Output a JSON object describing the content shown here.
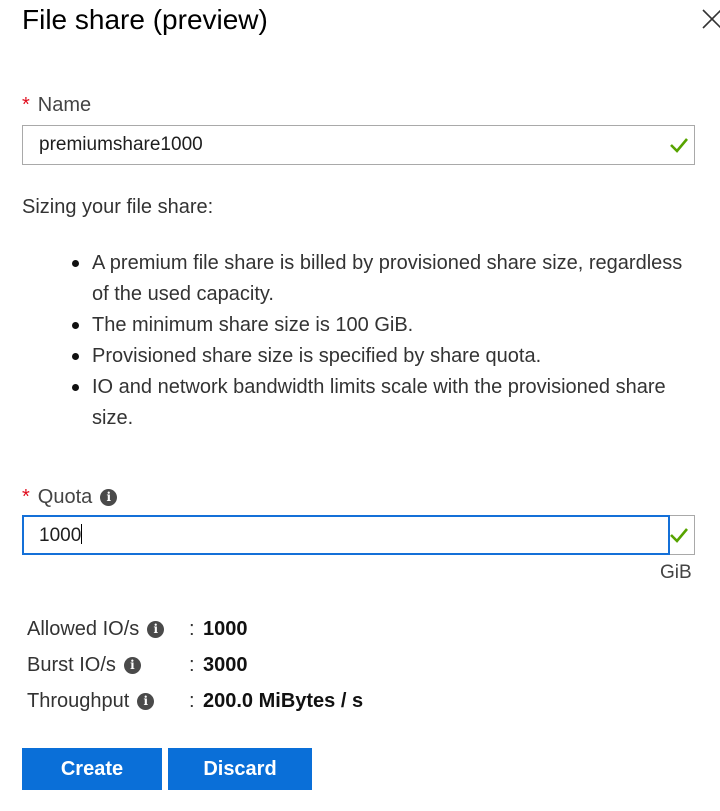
{
  "header": {
    "title": "File share (preview)",
    "close_icon": "close-icon"
  },
  "name_field": {
    "required_marker": "*",
    "label": "Name",
    "value": "premiumshare1000",
    "valid_icon": "checkmark-icon"
  },
  "sizing": {
    "heading": "Sizing your file share:",
    "bullets": [
      "A premium file share is billed by provisioned share size, regardless of the used capacity.",
      "The minimum share size is 100 GiB.",
      "Provisioned share size is specified by share quota.",
      "IO and network bandwidth limits scale with the provisioned share size."
    ]
  },
  "quota_field": {
    "required_marker": "*",
    "label": "Quota",
    "info_icon": "info-icon",
    "value": "1000",
    "unit": "GiB",
    "valid_icon": "checkmark-icon"
  },
  "stats": [
    {
      "label": "Allowed IO/s",
      "colon": ":",
      "value": "1000"
    },
    {
      "label": "Burst IO/s",
      "colon": ":",
      "value": "3000"
    },
    {
      "label": "Throughput",
      "colon": ":",
      "value": "200.0 MiBytes / s"
    }
  ],
  "buttons": {
    "create": "Create",
    "discard": "Discard"
  },
  "colors": {
    "accent": "#0a6fd8",
    "required": "#e00b1c",
    "valid": "#57a300",
    "focus": "#1470d8"
  }
}
